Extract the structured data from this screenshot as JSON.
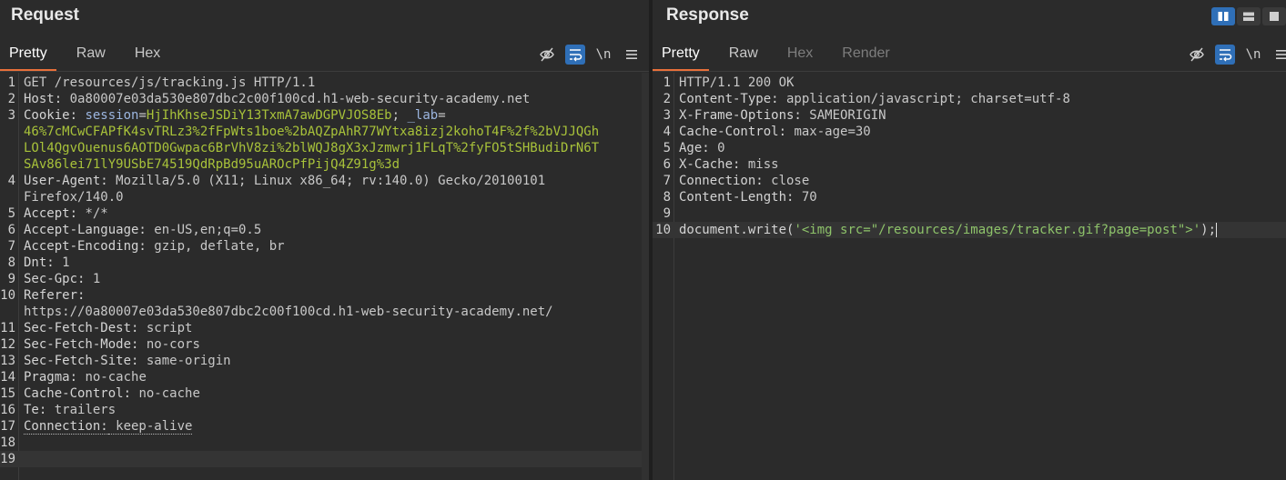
{
  "request": {
    "title": "Request",
    "tabs": [
      {
        "label": "Pretty",
        "active": true
      },
      {
        "label": "Raw",
        "active": false
      },
      {
        "label": "Hex",
        "active": false
      }
    ],
    "toolbar": {
      "hide_icon": "eye-slash-icon",
      "wrap_icon": "wrap-lines-icon",
      "newline_label": "\\n",
      "menu_icon": "hamburger-menu-icon"
    },
    "lines": [
      {
        "n": "1",
        "name": "",
        "value": "GET /resources/js/tracking.js HTTP/1.1"
      },
      {
        "n": "2",
        "name": "Host:",
        "value": " 0a80007e03da530e807dbc2c00f100cd.h1-web-security-academy.net"
      },
      {
        "n": "3",
        "name": "Cookie:",
        "cookie_name": " session",
        "eq": "=",
        "cookie_value": "HjIhKhseJSDiY13TxmA7awDGPVJOS8Eb",
        "sep": "; ",
        "cookie2_name": "_lab",
        "eq2": "=",
        "cont": [
          "46%7cMCwCFAPfK4svTRLz3%2fFpWts1boe%2bAQZpAhR77WYtxa8izj2kohoT4F%2f%2bVJJQGh",
          "LOl4QgvOuenus6AOTD0Gwpac6BrVhV8zi%2blWQJ8gX3xJzmwrj1FLqT%2fyFO5tSHBudiDrN6T",
          "SAv86lei71lY9USbE74519QdRpBd95uAROcPfPijQ4Z91g%3d"
        ]
      },
      {
        "n": "4",
        "name": "User-Agent:",
        "value": " Mozilla/5.0 (X11; Linux x86_64; rv:140.0) Gecko/20100101",
        "cont": [
          "Firefox/140.0"
        ]
      },
      {
        "n": "5",
        "name": "Accept:",
        "value": " */*"
      },
      {
        "n": "6",
        "name": "Accept-Language:",
        "value": " en-US,en;q=0.5"
      },
      {
        "n": "7",
        "name": "Accept-Encoding:",
        "value": " gzip, deflate, br"
      },
      {
        "n": "8",
        "name": "Dnt:",
        "value": " 1"
      },
      {
        "n": "9",
        "name": "Sec-Gpc:",
        "value": " 1"
      },
      {
        "n": "10",
        "name": "Referer:",
        "value": "",
        "cont": [
          "https://0a80007e03da530e807dbc2c00f100cd.h1-web-security-academy.net/"
        ]
      },
      {
        "n": "11",
        "name": "Sec-Fetch-Dest:",
        "value": " script"
      },
      {
        "n": "12",
        "name": "Sec-Fetch-Mode:",
        "value": " no-cors"
      },
      {
        "n": "13",
        "name": "Sec-Fetch-Site:",
        "value": " same-origin"
      },
      {
        "n": "14",
        "name": "Pragma:",
        "value": " no-cache"
      },
      {
        "n": "15",
        "name": "Cache-Control:",
        "value": " no-cache"
      },
      {
        "n": "16",
        "name": "Te:",
        "value": " trailers"
      },
      {
        "n": "17",
        "name": "Connection:",
        "value": " keep-alive",
        "dotted": true
      },
      {
        "n": "18",
        "name": "",
        "value": ""
      },
      {
        "n": "19",
        "name": "",
        "value": "",
        "current": true
      }
    ]
  },
  "response": {
    "title": "Response",
    "tabs": [
      {
        "label": "Pretty",
        "active": true
      },
      {
        "label": "Raw",
        "active": false
      },
      {
        "label": "Hex",
        "active": false,
        "disabled": true
      },
      {
        "label": "Render",
        "active": false,
        "disabled": true
      }
    ],
    "layout_icons": [
      "split-columns-icon",
      "split-rows-icon",
      "single-pane-icon"
    ],
    "toolbar": {
      "hide_icon": "eye-slash-icon",
      "wrap_icon": "wrap-lines-icon",
      "newline_label": "\\n"
    },
    "lines": [
      {
        "n": "1",
        "name": "",
        "value": "HTTP/1.1 200 OK"
      },
      {
        "n": "2",
        "name": "Content-Type:",
        "value": " application/javascript; charset=utf-8"
      },
      {
        "n": "3",
        "name": "X-Frame-Options:",
        "value": " SAMEORIGIN"
      },
      {
        "n": "4",
        "name": "Cache-Control:",
        "value": " max-age=30"
      },
      {
        "n": "5",
        "name": "Age:",
        "value": " 0"
      },
      {
        "n": "6",
        "name": "X-Cache:",
        "value": " miss"
      },
      {
        "n": "7",
        "name": "Connection:",
        "value": " close"
      },
      {
        "n": "8",
        "name": "Content-Length:",
        "value": " 70"
      },
      {
        "n": "9",
        "name": "",
        "value": ""
      },
      {
        "n": "10",
        "js_pre": "document.write(",
        "js_str": "'<img src=\"/resources/images/tracker.gif?page=post\">'",
        "js_post": ");",
        "current": true
      }
    ]
  }
}
